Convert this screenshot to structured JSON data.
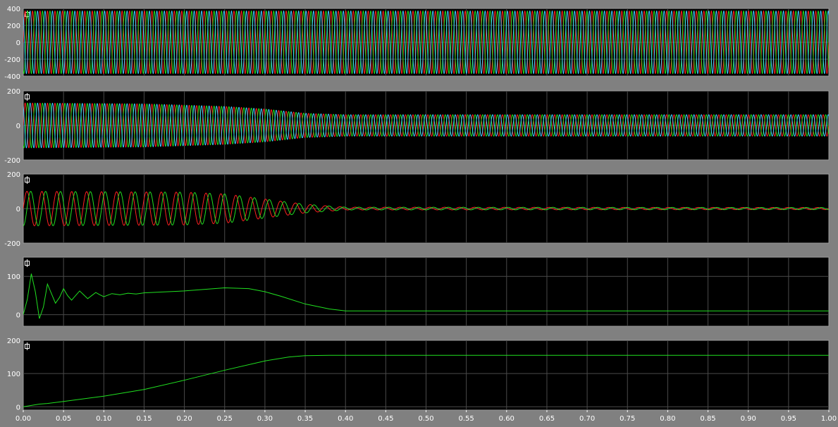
{
  "chart_data": [
    {
      "type": "line",
      "ylim": [
        -400,
        400
      ],
      "yticks": [
        400,
        200,
        0,
        -200,
        -400
      ],
      "xlim": [
        0,
        1
      ],
      "grid": true,
      "series": [
        {
          "kind": "sine3",
          "phase_deg": 0,
          "color": "#ff2020",
          "freq_hz": 108,
          "amp_points": [
            [
              0,
              370
            ],
            [
              1,
              370
            ]
          ]
        },
        {
          "kind": "sine3",
          "phase_deg": -120,
          "color": "#20e020",
          "freq_hz": 108,
          "amp_points": [
            [
              0,
              370
            ],
            [
              1,
              370
            ]
          ]
        },
        {
          "kind": "sine3",
          "phase_deg": 120,
          "color": "#40c8ff",
          "freq_hz": 108,
          "amp_points": [
            [
              0,
              370
            ],
            [
              1,
              370
            ]
          ]
        }
      ]
    },
    {
      "type": "line",
      "ylim": [
        -200,
        200
      ],
      "yticks": [
        200,
        0,
        -200
      ],
      "xlim": [
        0,
        1
      ],
      "grid": true,
      "series": [
        {
          "kind": "sine3",
          "phase_deg": 0,
          "color": "#ff2020",
          "freq_hz": 108,
          "amp_points": [
            [
              0,
              130
            ],
            [
              0.15,
              125
            ],
            [
              0.25,
              110
            ],
            [
              0.3,
              95
            ],
            [
              0.35,
              70
            ],
            [
              0.4,
              62
            ],
            [
              1,
              62
            ]
          ]
        },
        {
          "kind": "sine3",
          "phase_deg": -120,
          "color": "#20e020",
          "freq_hz": 108,
          "amp_points": [
            [
              0,
              130
            ],
            [
              0.15,
              125
            ],
            [
              0.25,
              110
            ],
            [
              0.3,
              95
            ],
            [
              0.35,
              70
            ],
            [
              0.4,
              62
            ],
            [
              1,
              62
            ]
          ]
        },
        {
          "kind": "sine3",
          "phase_deg": 120,
          "color": "#40c8ff",
          "freq_hz": 108,
          "amp_points": [
            [
              0,
              130
            ],
            [
              0.15,
              125
            ],
            [
              0.25,
              110
            ],
            [
              0.3,
              95
            ],
            [
              0.35,
              70
            ],
            [
              0.4,
              62
            ],
            [
              1,
              62
            ]
          ]
        }
      ]
    },
    {
      "type": "line",
      "ylim": [
        -200,
        200
      ],
      "yticks": [
        200,
        0,
        -200
      ],
      "xlim": [
        0,
        1
      ],
      "grid": true,
      "series": [
        {
          "kind": "sine3",
          "phase_deg": 0,
          "color": "#ff2020",
          "freq_hz": 54,
          "amp_points": [
            [
              0,
              100
            ],
            [
              0.2,
              95
            ],
            [
              0.25,
              85
            ],
            [
              0.3,
              55
            ],
            [
              0.35,
              25
            ],
            [
              0.4,
              8
            ],
            [
              1,
              6
            ]
          ]
        },
        {
          "kind": "sine3",
          "phase_deg": -90,
          "color": "#20e020",
          "freq_hz": 54,
          "amp_points": [
            [
              0,
              100
            ],
            [
              0.2,
              95
            ],
            [
              0.25,
              85
            ],
            [
              0.3,
              55
            ],
            [
              0.35,
              25
            ],
            [
              0.4,
              8
            ],
            [
              1,
              6
            ]
          ]
        }
      ]
    },
    {
      "type": "line",
      "ylim": [
        -30,
        150
      ],
      "yticks": [
        100,
        0
      ],
      "xlim": [
        0,
        1
      ],
      "grid": true,
      "series": [
        {
          "kind": "points",
          "color": "#20e020",
          "x": [
            0,
            0.005,
            0.01,
            0.015,
            0.02,
            0.025,
            0.03,
            0.035,
            0.04,
            0.045,
            0.05,
            0.055,
            0.06,
            0.065,
            0.07,
            0.075,
            0.08,
            0.085,
            0.09,
            0.095,
            0.1,
            0.11,
            0.12,
            0.13,
            0.14,
            0.15,
            0.17,
            0.2,
            0.25,
            0.28,
            0.3,
            0.32,
            0.35,
            0.38,
            0.4,
            0.45,
            0.5,
            1.0
          ],
          "y": [
            0,
            40,
            107,
            60,
            -10,
            20,
            80,
            55,
            30,
            45,
            68,
            50,
            38,
            50,
            62,
            52,
            42,
            50,
            58,
            52,
            47,
            55,
            52,
            56,
            54,
            57,
            59,
            62,
            70,
            68,
            60,
            48,
            28,
            15,
            10,
            10,
            10,
            10
          ]
        }
      ]
    },
    {
      "type": "line",
      "ylim": [
        -10,
        200
      ],
      "yticks": [
        200,
        100,
        0
      ],
      "xlim": [
        0,
        1
      ],
      "grid": true,
      "xticks": [
        "0.00",
        "0.05",
        "0.10",
        "0.15",
        "0.20",
        "0.25",
        "0.30",
        "0.35",
        "0.40",
        "0.45",
        "0.50",
        "0.55",
        "0.60",
        "0.65",
        "0.70",
        "0.75",
        "0.80",
        "0.85",
        "0.90",
        "0.95",
        "1.00"
      ],
      "series": [
        {
          "kind": "points",
          "color": "#20e020",
          "x": [
            0,
            0.01,
            0.02,
            0.03,
            0.05,
            0.1,
            0.15,
            0.2,
            0.25,
            0.3,
            0.33,
            0.35,
            0.38,
            1.0
          ],
          "y": [
            0,
            4,
            8,
            10,
            16,
            32,
            52,
            80,
            110,
            138,
            150,
            154,
            155,
            155
          ]
        }
      ]
    }
  ]
}
